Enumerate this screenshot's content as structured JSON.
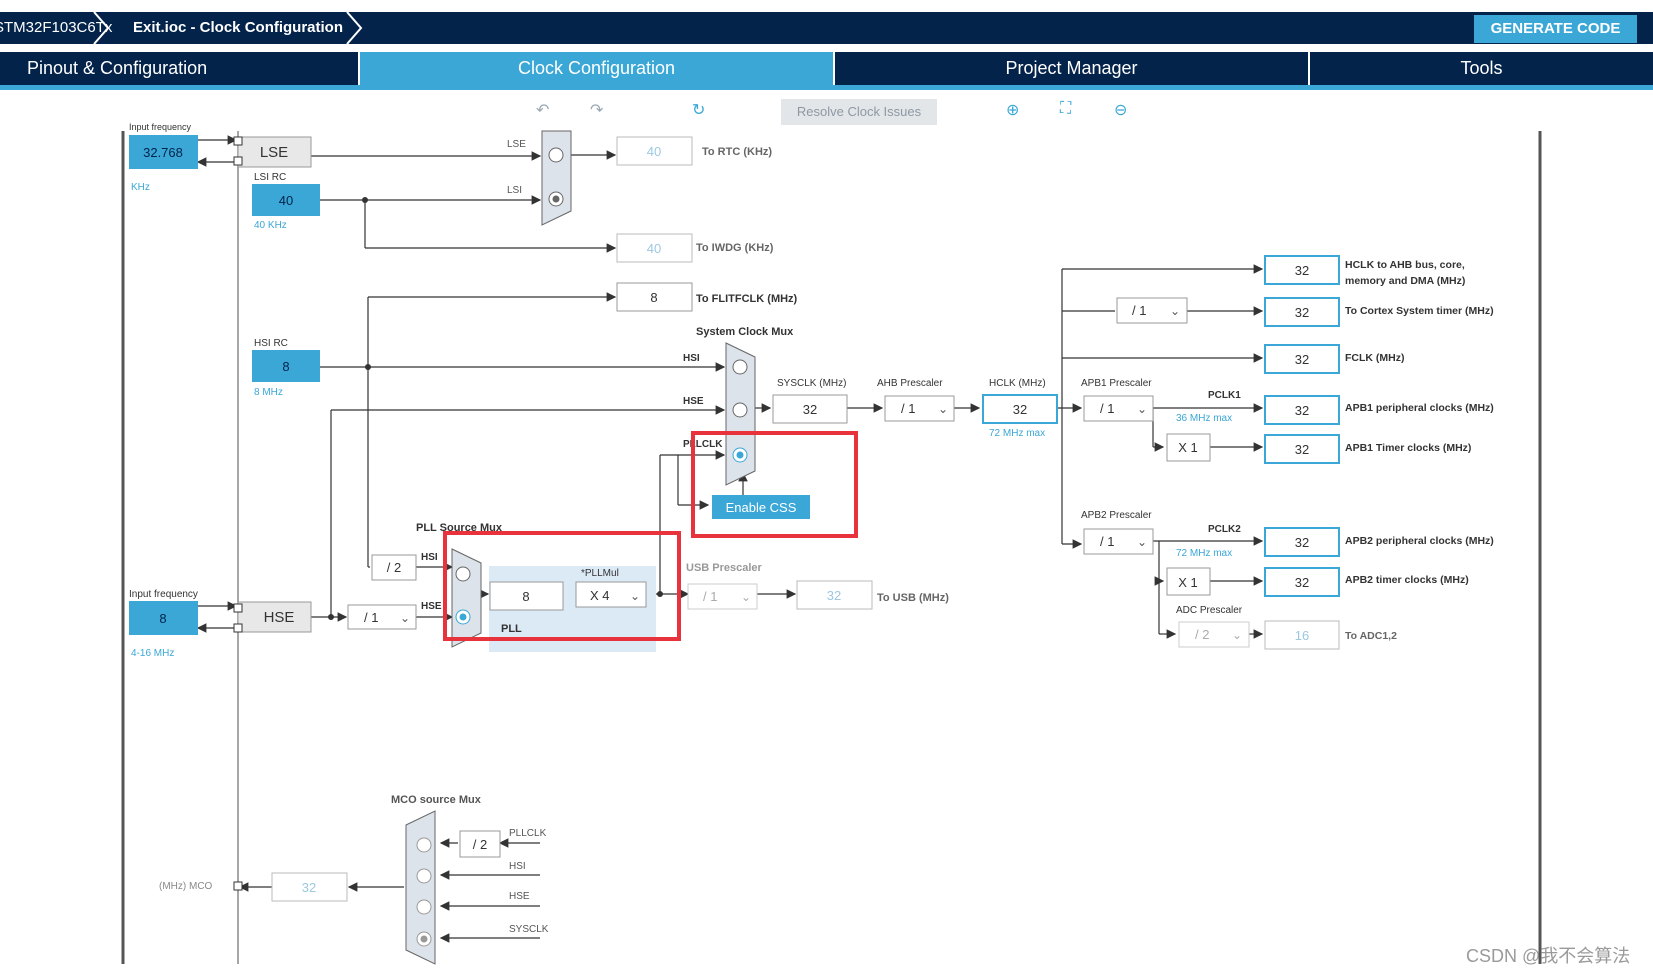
{
  "header": {
    "crumb_chip": "STM32F103C6Tx",
    "crumb_file": "Exit.ioc - Clock Configuration",
    "generate": "GENERATE CODE"
  },
  "tabs": [
    "Pinout & Configuration",
    "Clock Configuration",
    "Project Manager",
    "Tools"
  ],
  "toolbar": {
    "resolve": "Resolve Clock Issues",
    "icons": [
      "undo-icon",
      "redo-icon",
      "refresh-icon",
      "zoom-in-icon",
      "fit-icon",
      "zoom-out-icon"
    ]
  },
  "diagram": {
    "lse_input_label": "Input frequency",
    "lse_value": "32.768",
    "lse_unit": "KHz",
    "lse_block": "LSE",
    "lsi_label": "LSI RC",
    "lsi_value": "40",
    "lsi_unit": "40 KHz",
    "rtc_mux_lse": "LSE",
    "rtc_mux_lsi": "LSI",
    "rtc_value": "40",
    "rtc_label": "To RTC (KHz)",
    "iwdg_value": "40",
    "iwdg_label": "To IWDG (KHz)",
    "flit_value": "8",
    "flit_label": "To FLITFCLK (MHz)",
    "hsi_label": "HSI RC",
    "hsi_value": "8",
    "hsi_unit": "8 MHz",
    "hse_input_label": "Input frequency",
    "hse_value": "8",
    "hse_unit": "4-16 MHz",
    "hse_block": "HSE",
    "hse_div": "/ 1",
    "hsi_div2": "/ 2",
    "pll_src_mux": "PLL Source Mux",
    "pll_hsi": "HSI",
    "pll_hse": "HSE",
    "pll_value": "8",
    "pllmul_label": "*PLLMul",
    "pllmul_value": "X 4",
    "pll_label": "PLL",
    "usb_prescaler": "USB Prescaler",
    "usb_div": "/ 1",
    "usb_value": "32",
    "usb_label": "To USB (MHz)",
    "sys_mux": "System Clock Mux",
    "sys_hsi": "HSI",
    "sys_hse": "HSE",
    "sys_pllclk": "PLLCLK",
    "enable_css": "Enable CSS",
    "sysclk_label": "SYSCLK (MHz)",
    "sysclk_value": "32",
    "ahb_label": "AHB Prescaler",
    "ahb_value": "/ 1",
    "hclk_label": "HCLK (MHz)",
    "hclk_value": "32",
    "hclk_max": "72 MHz max",
    "apb1_label": "APB1 Prescaler",
    "apb1_value": "/ 1",
    "pclk1": "PCLK1",
    "pclk1_max": "36 MHz max",
    "apb1_timer_mul": "X 1",
    "apb2_label": "APB2 Prescaler",
    "apb2_value": "/ 1",
    "pclk2": "PCLK2",
    "pclk2_max": "72 MHz max",
    "apb2_timer_mul": "X 1",
    "adc_label": "ADC Prescaler",
    "adc_value": "/ 2",
    "cortex_div": "/ 1",
    "outputs": [
      {
        "value": "32",
        "line1": "HCLK to AHB bus, core,",
        "line2": "memory and DMA (MHz)"
      },
      {
        "value": "32",
        "line1": "To Cortex System timer (MHz)",
        "line2": ""
      },
      {
        "value": "32",
        "line1": "FCLK (MHz)",
        "line2": ""
      },
      {
        "value": "32",
        "line1": "APB1 peripheral clocks (MHz)",
        "line2": ""
      },
      {
        "value": "32",
        "line1": "APB1 Timer clocks (MHz)",
        "line2": ""
      },
      {
        "value": "32",
        "line1": "APB2 peripheral clocks (MHz)",
        "line2": ""
      },
      {
        "value": "32",
        "line1": "APB2 timer clocks (MHz)",
        "line2": ""
      },
      {
        "value": "16",
        "line1": "To ADC1,2",
        "line2": ""
      }
    ],
    "mco_mux": "MCO source Mux",
    "mco_div": "/ 2",
    "mco_pllclk": "PLLCLK",
    "mco_hsi": "HSI",
    "mco_hse": "HSE",
    "mco_sysclk": "SYSCLK",
    "mco_label": "(MHz) MCO",
    "mco_value": "32"
  },
  "watermark": "CSDN @我不会算法",
  "colors": {
    "navy": "#03234b",
    "accent": "#3aa7d7",
    "highlight": "#e8323c"
  }
}
